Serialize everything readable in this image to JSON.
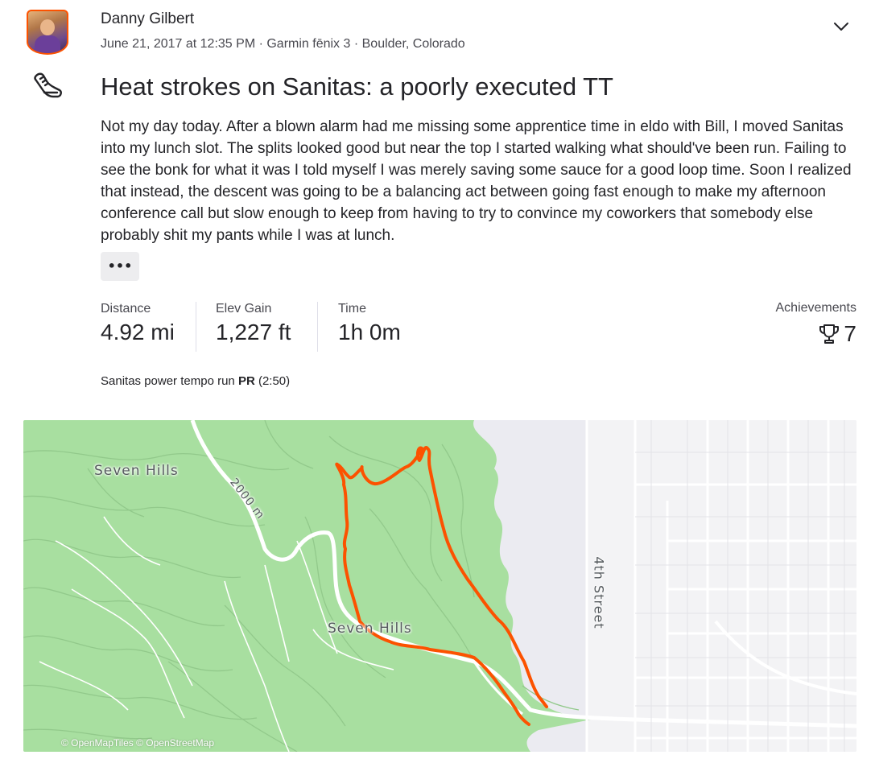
{
  "athlete": {
    "name": "Danny Gilbert",
    "meta": "June 21, 2017 at 12:35 PM · Garmin fēnix 3 · Boulder, Colorado"
  },
  "activity": {
    "type_icon": "running-shoe-icon",
    "title": "Heat strokes on Sanitas: a poorly executed TT",
    "description": "Not my day today. After a blown alarm had me missing some apprentice time in eldo with Bill, I moved Sanitas into my lunch slot. The splits looked good but near the top I started walking what should've been run. Failing to see the bonk for what it was I told myself I was merely saving some sauce for a good loop time. Soon I realized that instead, the descent was going to be a balancing act between going fast enough to make my afternoon conference call but slow enough to keep from having to try to convince my coworkers that somebody else probably shit my pants while I was at lunch.",
    "more_label": "•••"
  },
  "stats": [
    {
      "label": "Distance",
      "value": "4.92 mi"
    },
    {
      "label": "Elev Gain",
      "value": "1,227 ft"
    },
    {
      "label": "Time",
      "value": "1h 0m"
    }
  ],
  "achievements": {
    "label": "Achievements",
    "icon": "trophy-icon",
    "count": "7"
  },
  "segment": {
    "name": "Sanitas power tempo run",
    "badge": "PR",
    "time": "(2:50)"
  },
  "map": {
    "labels": {
      "seven_hills_top": "Seven Hills",
      "seven_hills_bottom": "Seven Hills",
      "contour": "2000 m",
      "street": "4th Street"
    },
    "attribution": "© OpenMapTiles © OpenStreetMap",
    "colors": {
      "forest": "#a8dfa0",
      "route": "#fc5200",
      "land": "#f3f3f5",
      "road": "#ffffff"
    }
  },
  "colors": {
    "brand": "#fc5200",
    "text": "#242428",
    "muted": "#494950"
  }
}
